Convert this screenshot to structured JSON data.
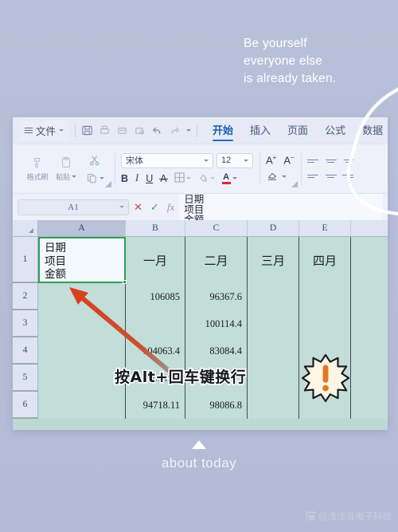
{
  "poster": {
    "quote_lines": [
      "Be yourself",
      "everyone else",
      "is already taken."
    ],
    "caption": "about today",
    "watermark": "@浅浅说电子科技",
    "bg_color": "#b6bed8"
  },
  "app": {
    "menubar": {
      "file_label": "文件",
      "quick_icons": [
        "save-icon",
        "print-icon",
        "print-preview-icon",
        "print-area-icon",
        "undo-icon",
        "redo-icon",
        "customize-dropdown-icon"
      ],
      "tabs": [
        {
          "label": "开始",
          "active": true
        },
        {
          "label": "插入",
          "active": false
        },
        {
          "label": "页面",
          "active": false
        },
        {
          "label": "公式",
          "active": false
        },
        {
          "label": "数据",
          "active": false
        }
      ]
    },
    "ribbon": {
      "clipboard": [
        {
          "label": "格式刷",
          "icon": "format-painter-icon"
        },
        {
          "label": "粘贴",
          "icon": "paste-icon"
        },
        {
          "label": "",
          "icon": "cut-icon"
        },
        {
          "label": "",
          "icon": "copy-icon"
        }
      ],
      "font_name": "宋体",
      "font_size": "12",
      "bold": "B",
      "italic": "I",
      "underline": "U",
      "strikethrough": "A",
      "border_icon": "borders-icon",
      "fill_icon": "fill-color-icon",
      "font_color_icon": "font-color-icon",
      "font_color_hex": "#d92b2b",
      "increase_size": "A",
      "decrease_size": "A",
      "clear_icon": "clear-format-icon"
    },
    "formula_bar": {
      "name_box": "A1",
      "cancel_icon": "cancel-icon",
      "confirm_icon": "confirm-icon",
      "function_icon": "fx-icon",
      "content_lines": [
        "日期",
        "项目",
        "金额"
      ]
    },
    "sheet": {
      "columns": [
        "A",
        "B",
        "C",
        "D",
        "E"
      ],
      "selected_column": "A",
      "active_cell": "A1",
      "active_cell_lines": [
        "日期",
        "项目",
        "金额"
      ],
      "rows": [
        {
          "num": "1",
          "cells": [
            "",
            "一月",
            "二月",
            "三月",
            "四月",
            ""
          ]
        },
        {
          "num": "2",
          "cells": [
            "",
            "106085",
            "96367.6",
            "",
            "",
            ""
          ]
        },
        {
          "num": "3",
          "cells": [
            "",
            "",
            "100114.4",
            "",
            "",
            ""
          ]
        },
        {
          "num": "4",
          "cells": [
            "",
            "104063.4",
            "83084.4",
            "",
            "",
            ""
          ]
        },
        {
          "num": "5",
          "cells": [
            "",
            "101498.",
            "",
            "",
            "",
            ""
          ]
        },
        {
          "num": "6",
          "cells": [
            "",
            "94718.11",
            "98086.8",
            "",
            "",
            ""
          ]
        }
      ]
    }
  },
  "annotation": {
    "text": "按Alt+回车键换行",
    "badge_icon": "exclamation-burst-icon",
    "arrow_icon": "red-arrow-icon",
    "arrow_color": "#d9401f"
  }
}
